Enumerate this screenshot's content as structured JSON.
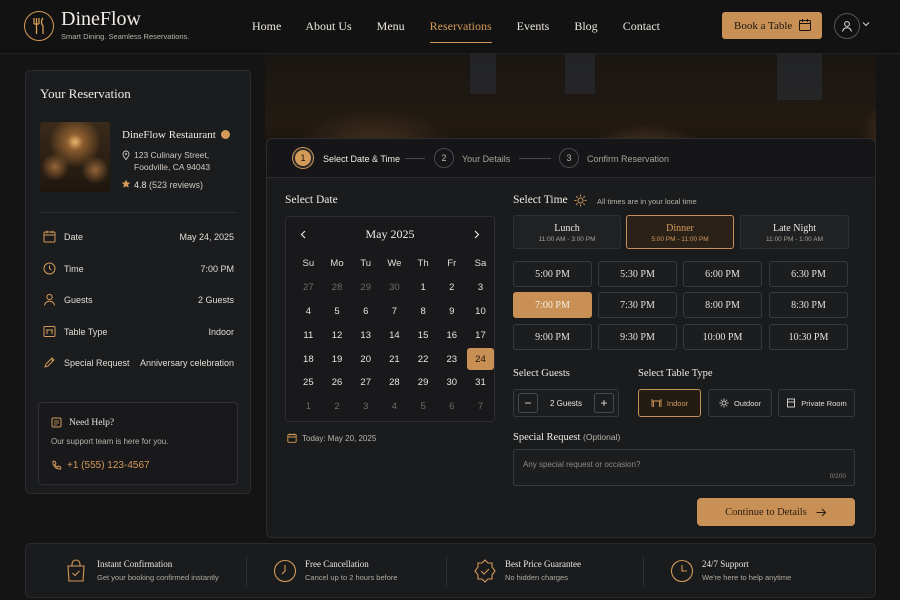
{
  "brand": {
    "name": "DineFlow",
    "tagline": "Smart Dining. Seamless Reservations."
  },
  "nav": {
    "items": [
      {
        "label": "Home"
      },
      {
        "label": "About Us"
      },
      {
        "label": "Menu"
      },
      {
        "label": "Reservations",
        "active": true
      },
      {
        "label": "Events"
      },
      {
        "label": "Blog"
      },
      {
        "label": "Contact"
      }
    ],
    "book_label": "Book a Table"
  },
  "summary": {
    "title": "Your Reservation",
    "restaurant": {
      "name": "DineFlow Restaurant",
      "address_line1": "123 Culinary Street,",
      "address_line2": "Foodville, CA 94043",
      "rating": "4.8",
      "reviews": "(523 reviews)"
    },
    "details": [
      {
        "label": "Date",
        "value": "May 24, 2025",
        "icon": "calendar-icon"
      },
      {
        "label": "Time",
        "value": "7:00 PM",
        "icon": "clock-icon"
      },
      {
        "label": "Guests",
        "value": "2 Guests",
        "icon": "user-icon"
      },
      {
        "label": "Table Type",
        "value": "Indoor",
        "icon": "table-icon"
      },
      {
        "label": "Special Request",
        "value": "Anniversary celebration",
        "icon": "pen-icon"
      }
    ],
    "help": {
      "title": "Need Help?",
      "subtitle": "Our support team is here for you.",
      "phone": "+1 (555) 123-4567"
    }
  },
  "steps": [
    {
      "num": "1",
      "label": "Select Date & Time",
      "active": true
    },
    {
      "num": "2",
      "label": "Your Details"
    },
    {
      "num": "3",
      "label": "Confirm Reservation"
    }
  ],
  "date_section": {
    "title": "Select Date",
    "month": "May 2025",
    "weekdays": [
      "Su",
      "Mo",
      "Tu",
      "We",
      "Th",
      "Fr",
      "Sa"
    ],
    "days": [
      "27",
      "28",
      "29",
      "30",
      "1",
      "2",
      "3",
      "4",
      "5",
      "6",
      "7",
      "8",
      "9",
      "10",
      "11",
      "12",
      "13",
      "14",
      "15",
      "16",
      "17",
      "18",
      "19",
      "20",
      "21",
      "22",
      "23",
      "24",
      "25",
      "26",
      "27",
      "28",
      "29",
      "30",
      "31",
      "1",
      "2",
      "3",
      "4",
      "5",
      "6",
      "7"
    ],
    "muted_indices": [
      0,
      1,
      2,
      3,
      35,
      36,
      37,
      38,
      39,
      40,
      41
    ],
    "selected_index": 27,
    "today": "Today: May 20, 2025"
  },
  "time_section": {
    "title": "Select Time",
    "note": "All times are in your local time",
    "meals": [
      {
        "name": "Lunch",
        "hours": "11:00 AM - 3:00 PM"
      },
      {
        "name": "Dinner",
        "hours": "5:00 PM - 11:00 PM",
        "active": true
      },
      {
        "name": "Late Night",
        "hours": "11:00 PM - 1:00 AM"
      }
    ],
    "slots": [
      "5:00 PM",
      "5:30 PM",
      "6:00 PM",
      "6:30 PM",
      "7:00 PM",
      "7:30 PM",
      "8:00 PM",
      "8:30 PM",
      "9:00 PM",
      "9:30 PM",
      "10:00 PM",
      "10:30 PM"
    ],
    "selected_slot": 4
  },
  "guests": {
    "title": "Select Guests",
    "value": "2 Guests",
    "minus": "−",
    "plus": "+"
  },
  "table_type": {
    "title": "Select Table Type",
    "options": [
      {
        "label": "Indoor",
        "active": true
      },
      {
        "label": "Outdoor"
      },
      {
        "label": "Private Room"
      }
    ]
  },
  "special_request": {
    "title": "Special Request",
    "optional": "(Optional)",
    "placeholder": "Any special request or occasion?",
    "count": "0/200"
  },
  "continue_label": "Continue to Details",
  "features": [
    {
      "title": "Instant Confirmation",
      "subtitle": "Get your booking confirmed instantly",
      "icon": "bag-check-icon"
    },
    {
      "title": "Free Cancellation",
      "subtitle": "Cancel up to 2 hours before",
      "icon": "timer-icon"
    },
    {
      "title": "Best Price Guarantee",
      "subtitle": "No hidden charges",
      "icon": "badge-icon"
    },
    {
      "title": "24/7 Support",
      "subtitle": "We're here to help anytime",
      "icon": "clock-icon"
    }
  ],
  "colors": {
    "accent": "#c99056",
    "accent_text": "#d39a58",
    "background": "#141414",
    "panel": "#1b1c1e"
  }
}
